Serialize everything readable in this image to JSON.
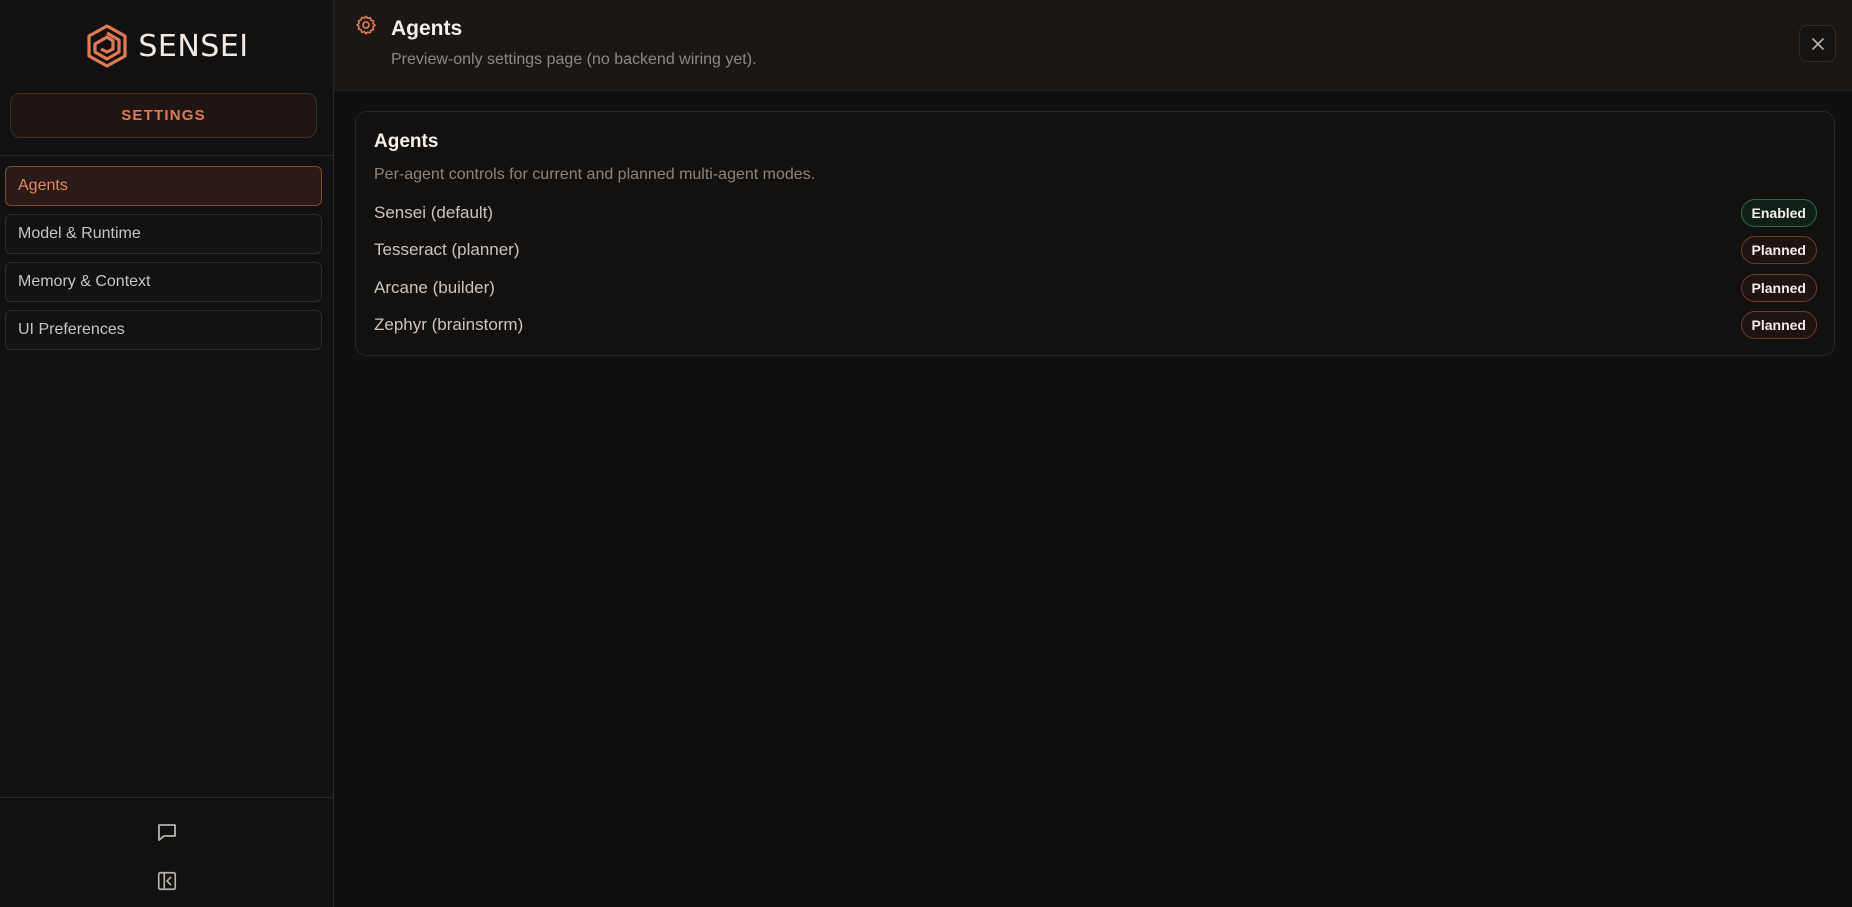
{
  "brand": {
    "name": "SENSEI",
    "accent": "#e07b4f"
  },
  "sidebar": {
    "settings_label": "SETTINGS",
    "items": [
      {
        "label": "Agents",
        "active": true
      },
      {
        "label": "Model & Runtime",
        "active": false
      },
      {
        "label": "Memory & Context",
        "active": false
      },
      {
        "label": "UI Preferences",
        "active": false
      }
    ],
    "bottom_icons": [
      "chat-icon",
      "collapse-sidebar-icon"
    ]
  },
  "header": {
    "icon": "gear-icon",
    "title": "Agents",
    "subtitle": "Preview-only settings page (no backend wiring yet).",
    "close_icon": "close-icon"
  },
  "card": {
    "title": "Agents",
    "description": "Per-agent controls for current and planned multi-agent modes.",
    "agents": [
      {
        "name": "Sensei (default)",
        "status": "Enabled",
        "status_color": "#2f6b4a"
      },
      {
        "name": "Tesseract (planner)",
        "status": "Planned",
        "status_color": "#6b3b2c"
      },
      {
        "name": "Arcane (builder)",
        "status": "Planned",
        "status_color": "#6b3b2c"
      },
      {
        "name": "Zephyr (brainstorm)",
        "status": "Planned",
        "status_color": "#6b3b2c"
      }
    ]
  }
}
